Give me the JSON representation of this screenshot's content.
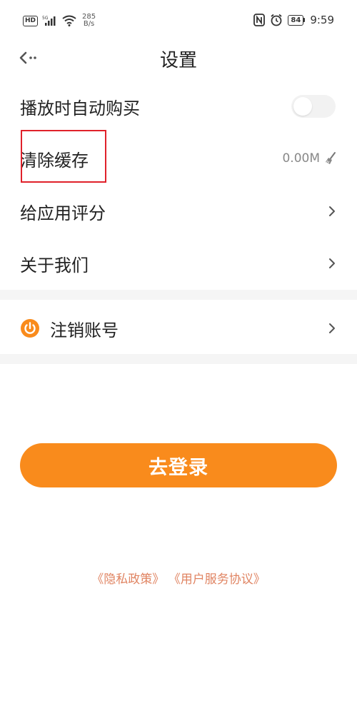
{
  "status_bar": {
    "network_badge": "HD",
    "signal_label": "5G",
    "speed_value": "285",
    "speed_unit": "B/s",
    "battery": "84",
    "time": "9:59"
  },
  "header": {
    "title": "设置"
  },
  "settings": {
    "auto_buy_label": "播放时自动购买",
    "clear_cache_label": "清除缓存",
    "cache_size": "0.00M",
    "rate_app_label": "给应用评分",
    "about_label": "关于我们",
    "logout_label": "注销账号"
  },
  "toggle": {
    "auto_buy_on": false
  },
  "login_button": "去登录",
  "links": {
    "privacy": "《隐私政策》",
    "user_agreement": "《用户服务协议》"
  },
  "colors": {
    "accent": "#f98b1c",
    "link": "#e08462",
    "highlight": "#e0212a"
  }
}
